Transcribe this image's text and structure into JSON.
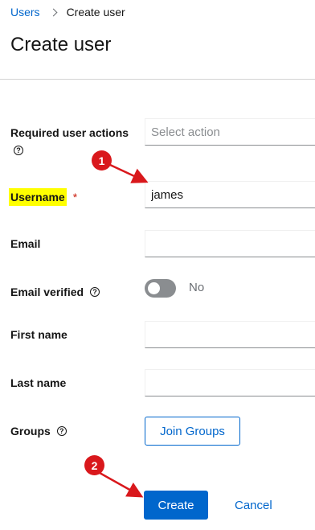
{
  "breadcrumb": {
    "parent": "Users",
    "current": "Create user"
  },
  "page_title": "Create user",
  "form": {
    "required_actions": {
      "label": "Required user actions",
      "placeholder": "Select action"
    },
    "username": {
      "label": "Username",
      "required_mark": "*",
      "value": "james"
    },
    "email": {
      "label": "Email",
      "value": ""
    },
    "email_verified": {
      "label": "Email verified",
      "state_text": "No",
      "on": false
    },
    "first_name": {
      "label": "First name",
      "value": ""
    },
    "last_name": {
      "label": "Last name",
      "value": ""
    },
    "groups": {
      "label": "Groups",
      "button": "Join Groups"
    }
  },
  "actions": {
    "create": "Create",
    "cancel": "Cancel"
  },
  "help_glyph": "?",
  "annotations": {
    "step1": "1",
    "step2": "2"
  },
  "colors": {
    "primary": "#0066cc",
    "highlight": "#ffff00",
    "annotation_red": "#d9181c",
    "required": "#c9190b"
  },
  "icons": {
    "help": "question-circle-icon",
    "separator": "chevron-right-icon"
  }
}
